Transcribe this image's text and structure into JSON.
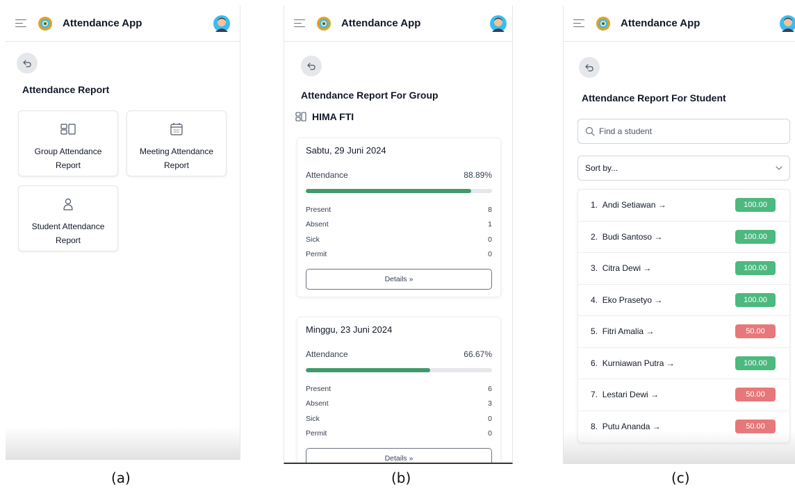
{
  "app": {
    "title": "Attendance App"
  },
  "panel_a": {
    "caption": "(a)",
    "page_title": "Attendance Report",
    "cards": [
      {
        "label": "Group Attendance Report",
        "icon": "group-icon"
      },
      {
        "label": "Meeting Attendance Report",
        "icon": "calendar-icon"
      },
      {
        "label": "Student Attendance Report",
        "icon": "user-icon"
      }
    ]
  },
  "panel_b": {
    "caption": "(b)",
    "page_title": "Attendance Report For Group",
    "group_name": "HIMA FTI",
    "meetings": [
      {
        "date": "Sabtu, 29 Juni 2024",
        "attendance_label": "Attendance",
        "attendance_value": "88.89%",
        "attendance_fraction": 0.8889,
        "stats": [
          {
            "label": "Present",
            "value": "8"
          },
          {
            "label": "Absent",
            "value": "1"
          },
          {
            "label": "Sick",
            "value": "0"
          },
          {
            "label": "Permit",
            "value": "0"
          }
        ],
        "details_label": "Details »"
      },
      {
        "date": "Minggu, 23 Juni 2024",
        "attendance_label": "Attendance",
        "attendance_value": "66.67%",
        "attendance_fraction": 0.6667,
        "stats": [
          {
            "label": "Present",
            "value": "6"
          },
          {
            "label": "Absent",
            "value": "3"
          },
          {
            "label": "Sick",
            "value": "0"
          },
          {
            "label": "Permit",
            "value": "0"
          }
        ],
        "details_label": "Details »"
      }
    ]
  },
  "panel_c": {
    "caption": "(c)",
    "page_title": "Attendance Report For Student",
    "search_placeholder": "Find a student",
    "sort_label": "Sort by...",
    "students": [
      {
        "rank": "1.",
        "name": "Andi Setiawan →",
        "score": "100.00",
        "status": "good"
      },
      {
        "rank": "2.",
        "name": "Budi Santoso →",
        "score": "100.00",
        "status": "good"
      },
      {
        "rank": "3.",
        "name": "Citra Dewi →",
        "score": "100.00",
        "status": "good"
      },
      {
        "rank": "4.",
        "name": "Eko Prasetyo →",
        "score": "100.00",
        "status": "good"
      },
      {
        "rank": "5.",
        "name": "Fitri Amalia →",
        "score": "50.00",
        "status": "bad"
      },
      {
        "rank": "6.",
        "name": "Kurniawan Putra →",
        "score": "100.00",
        "status": "good"
      },
      {
        "rank": "7.",
        "name": "Lestari Dewi →",
        "score": "50.00",
        "status": "bad"
      },
      {
        "rank": "8.",
        "name": "Putu Ananda →",
        "score": "50.00",
        "status": "bad"
      }
    ]
  },
  "colors": {
    "good": "#4cb97e",
    "bad": "#e8777a",
    "progress": "#3e9a6a"
  }
}
